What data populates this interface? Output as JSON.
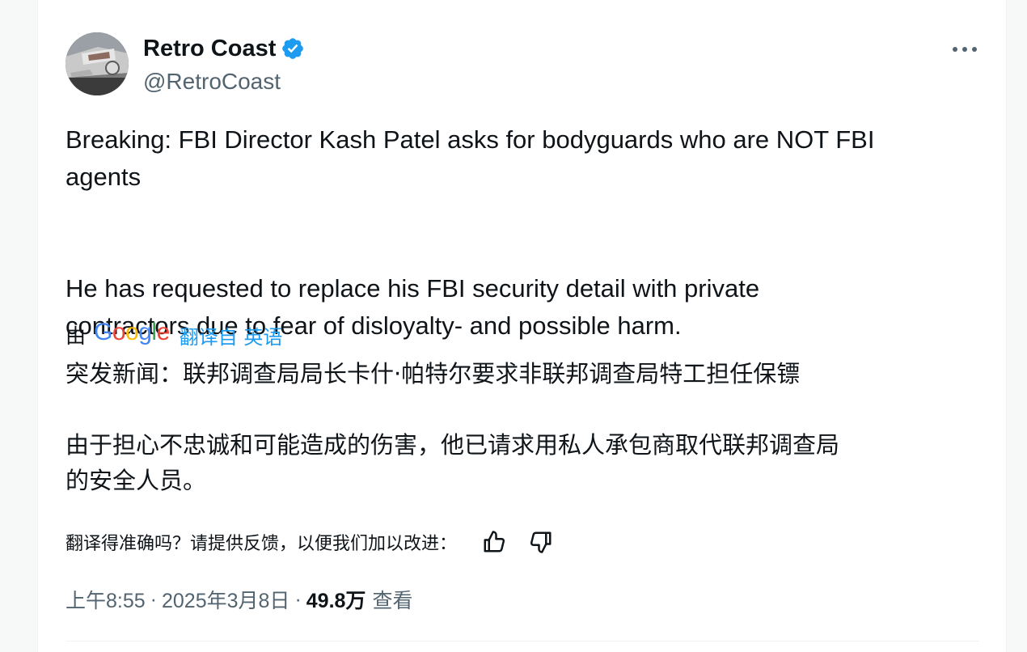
{
  "author": {
    "display_name": "Retro Coast",
    "handle": "@RetroCoast",
    "verified": true,
    "avatar_icon": "car-chrome-avatar"
  },
  "tweet": {
    "text": "Breaking: FBI Director Kash Patel asks for bodyguards who are NOT FBI\nagents\n\n\nHe has requested to replace his FBI security detail with private\ncontractors due to fear of disloyalty- and possible harm."
  },
  "translation": {
    "by_label": "由",
    "provider": "Google",
    "translated_from": "翻译自 英语",
    "text": "突发新闻：联邦调查局局长卡什·帕特尔要求非联邦调查局特工担任保镖\n\n由于担心不忠诚和可能造成的伤害，他已请求用私人承包商取代联邦调查局\n的安全人员。",
    "feedback_prompt": "翻译得准确吗？请提供反馈，以便我们加以改进："
  },
  "meta": {
    "time": "上午8:55",
    "separator": "·",
    "date": "2025年3月8日",
    "views_count": "49.8万",
    "views_label": "查看"
  },
  "colors": {
    "accent": "#1d9bf0",
    "secondary_text": "#536471",
    "primary_text": "#0f1419",
    "google_blue": "#4285F4",
    "google_red": "#EA4335",
    "google_yellow": "#FBBC05",
    "google_green": "#34A853"
  },
  "icons": {
    "more": "more-horizontal-icon",
    "thumbs_up": "thumbs-up-icon",
    "thumbs_down": "thumbs-down-icon",
    "verified": "verified-badge-icon"
  }
}
